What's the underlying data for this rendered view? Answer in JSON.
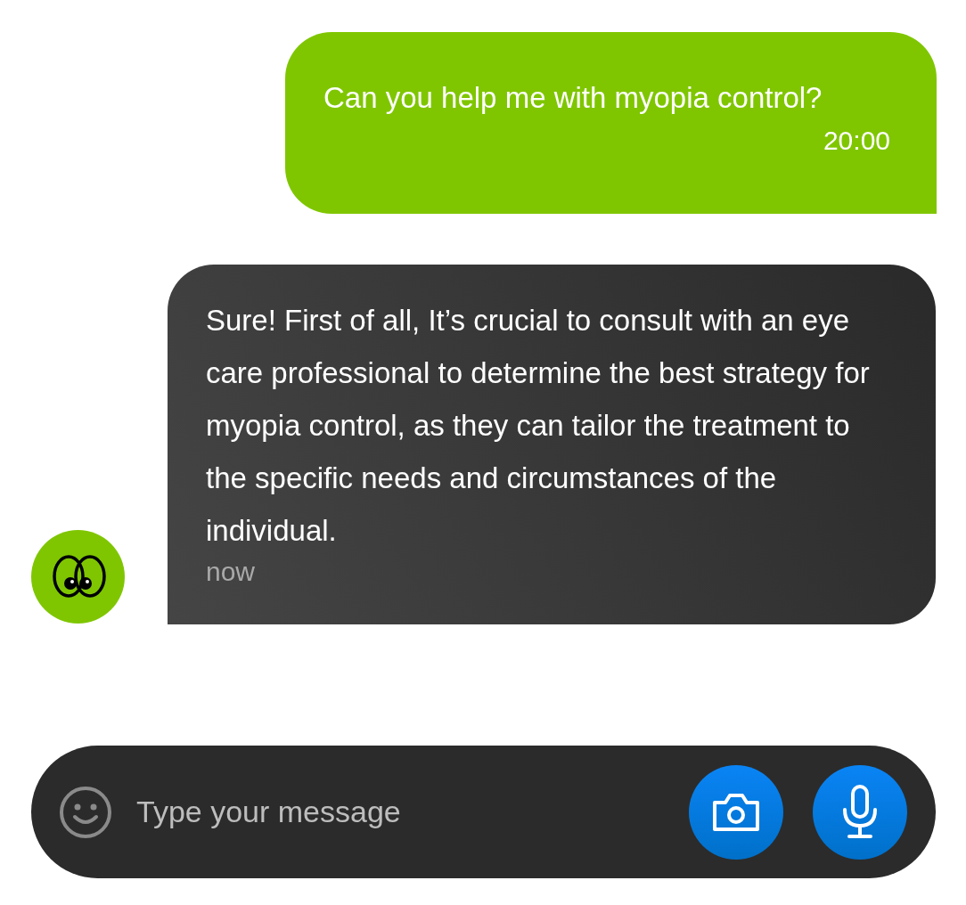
{
  "messages": [
    {
      "kind": "outgoing",
      "text": "Can you help me with myopia control?",
      "time": "20:00"
    },
    {
      "kind": "incoming",
      "text": "Sure! First of all, It’s crucial to consult with an eye care professional to determine the best strategy for myopia control, as they can tailor the treatment to the specific needs and circumstances of the individual.",
      "time": "now"
    }
  ],
  "composer": {
    "placeholder": "Type your message"
  }
}
